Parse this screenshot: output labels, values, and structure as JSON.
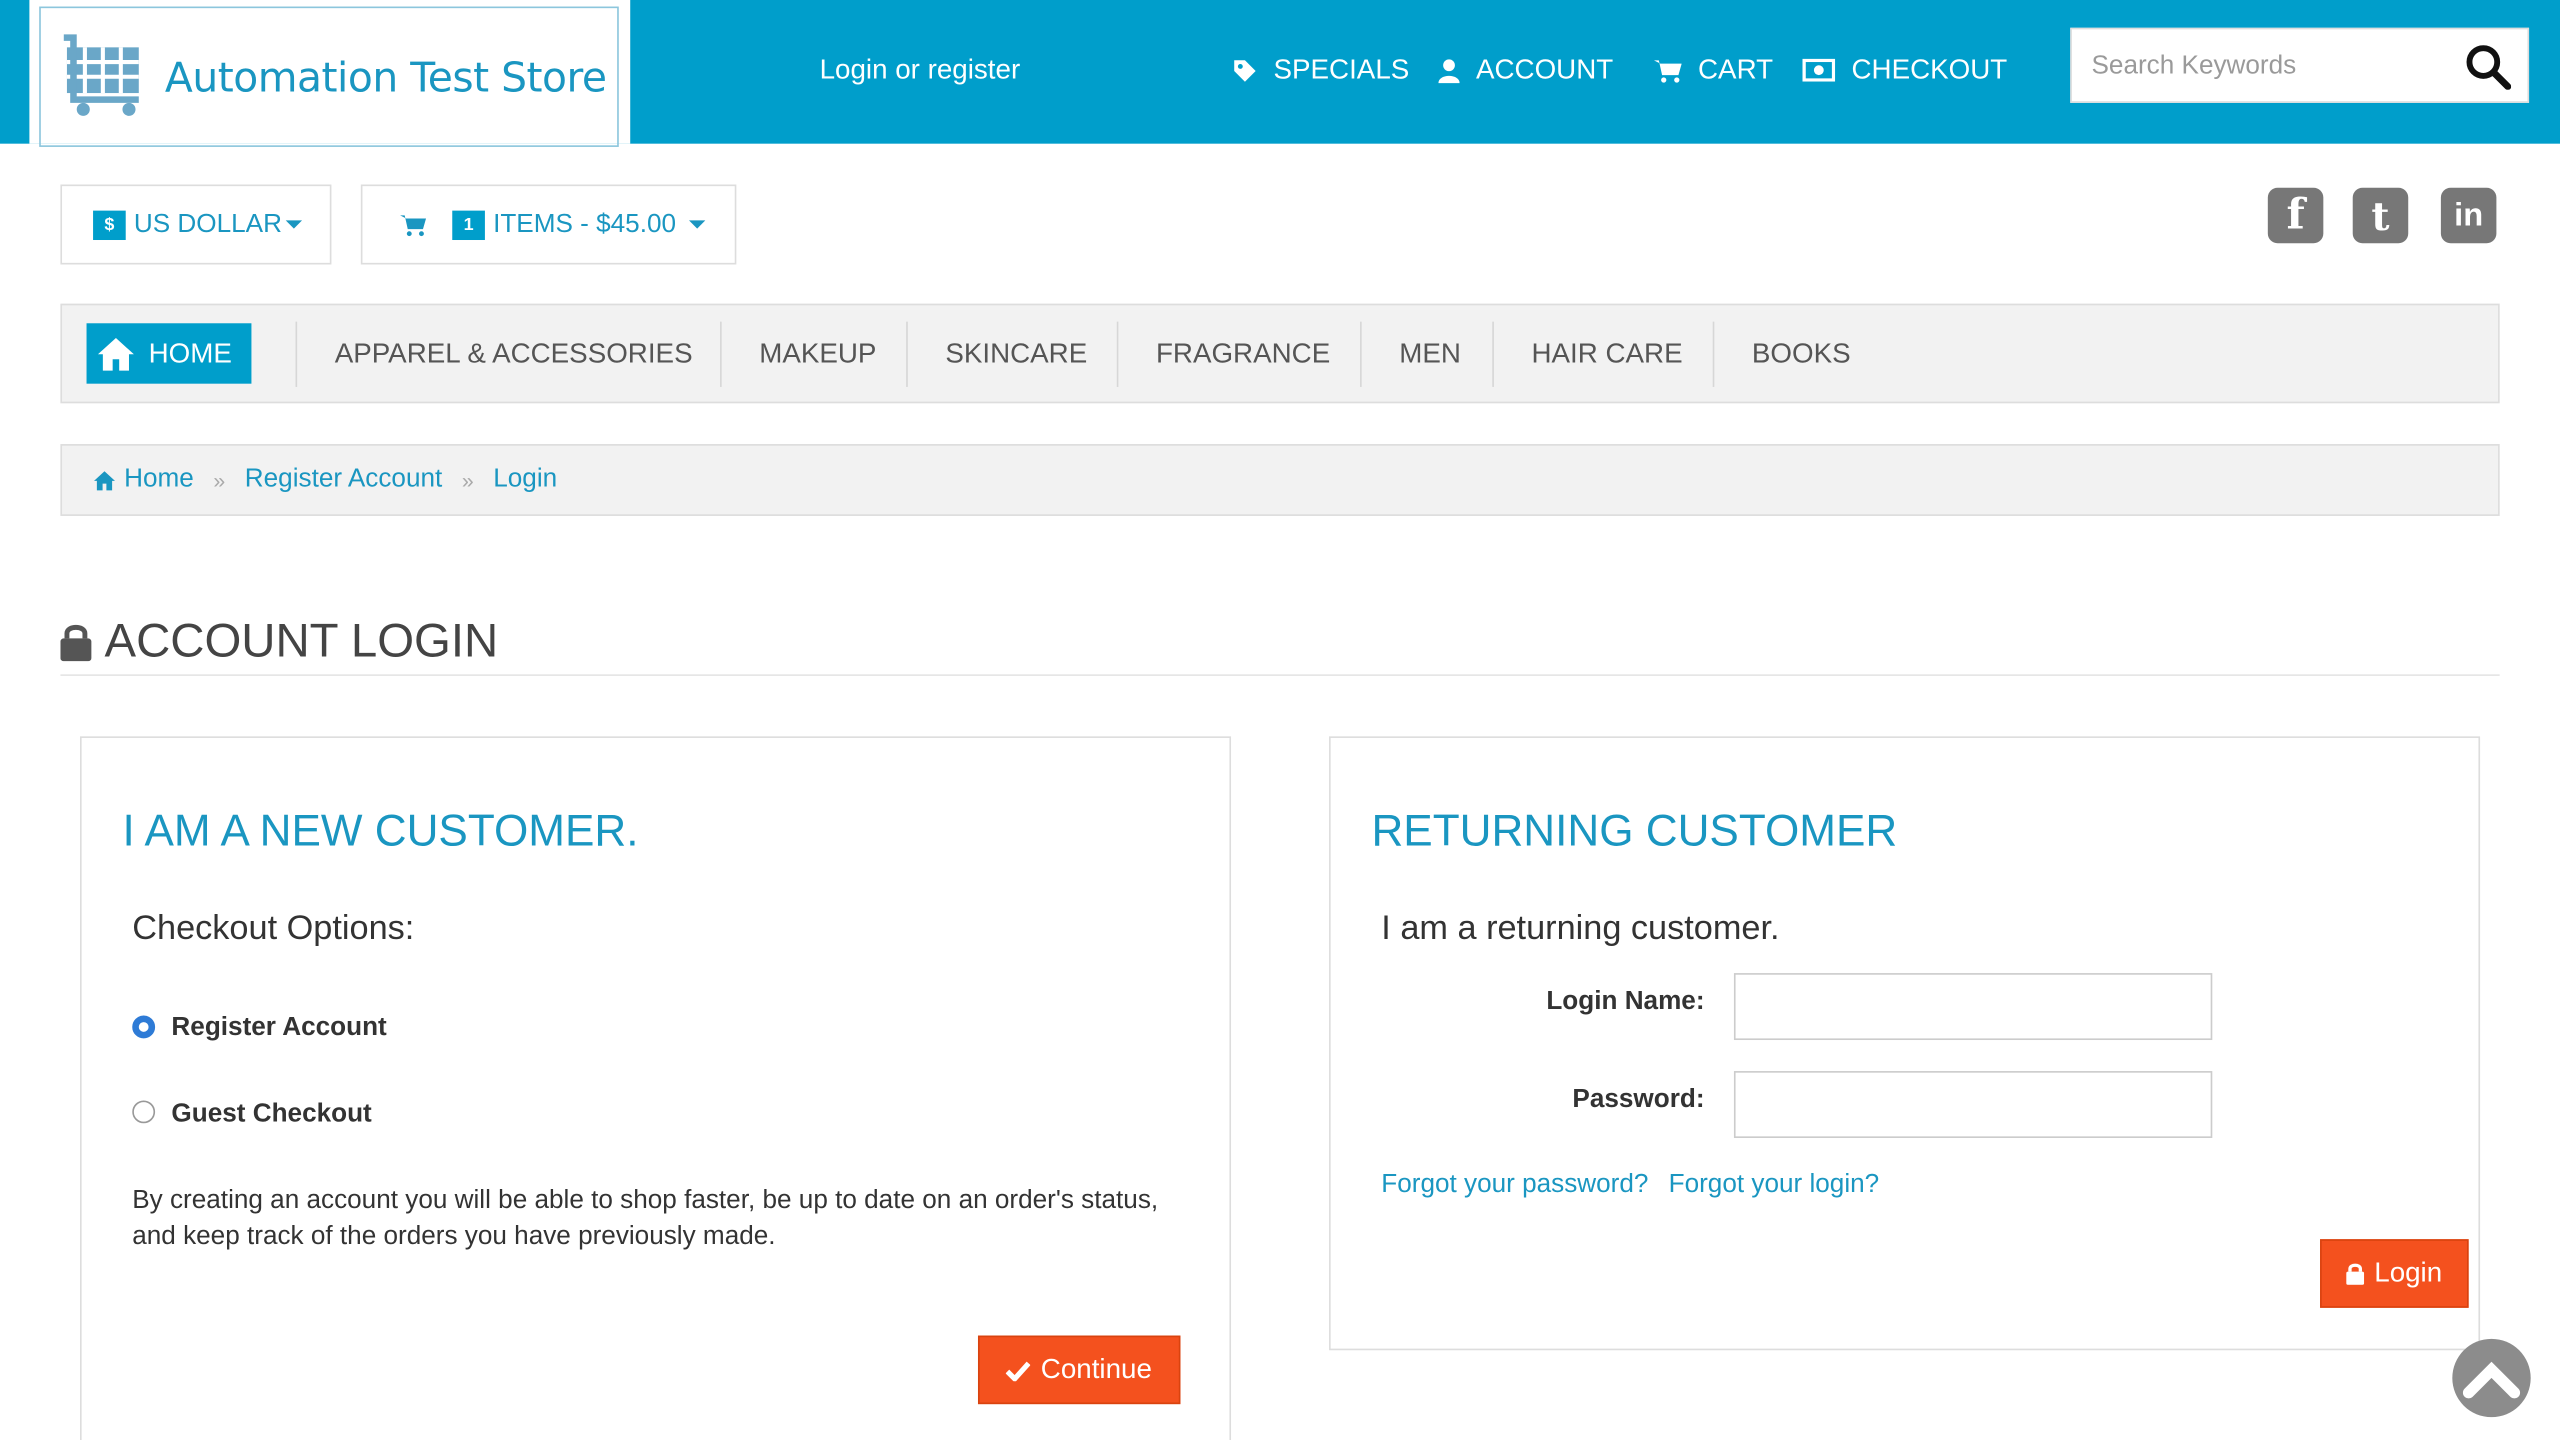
{
  "header": {
    "logo_text": "Automation Test Store",
    "login_register": "Login or register",
    "nav": {
      "specials": "SPECIALS",
      "account": "ACCOUNT",
      "cart": "CART",
      "checkout": "CHECKOUT"
    },
    "search": {
      "placeholder": "Search Keywords"
    }
  },
  "toolbar": {
    "currency_symbol": "$",
    "currency_label": "US DOLLAR",
    "cart_count": "1",
    "cart_summary": "ITEMS - $45.00"
  },
  "social": [
    "facebook-icon",
    "twitter-icon",
    "linkedin-icon"
  ],
  "categories": {
    "home": "HOME",
    "items": [
      "APPAREL & ACCESSORIES",
      "MAKEUP",
      "SKINCARE",
      "FRAGRANCE",
      "MEN",
      "HAIR CARE",
      "BOOKS"
    ]
  },
  "breadcrumb": [
    "Home",
    "Register Account",
    "Login"
  ],
  "page_title": "ACCOUNT LOGIN",
  "new_customer": {
    "title": "I AM A NEW CUSTOMER.",
    "subtitle": "Checkout Options:",
    "option_register": "Register Account",
    "option_guest": "Guest Checkout",
    "selected": "Register Account",
    "description": "By creating an account you will be able to shop faster, be up to date on an order's status, and keep track of the orders you have previously made.",
    "continue_label": "Continue"
  },
  "returning_customer": {
    "title": "RETURNING CUSTOMER",
    "subtitle": "I am a returning customer.",
    "login_name_label": "Login Name:",
    "login_name_value": "",
    "password_label": "Password:",
    "password_value": "",
    "forgot_password": "Forgot your password?",
    "forgot_login": "Forgot your login?",
    "login_label": "Login"
  },
  "colors": {
    "brand": "#009ecb",
    "action": "#f4511e"
  }
}
